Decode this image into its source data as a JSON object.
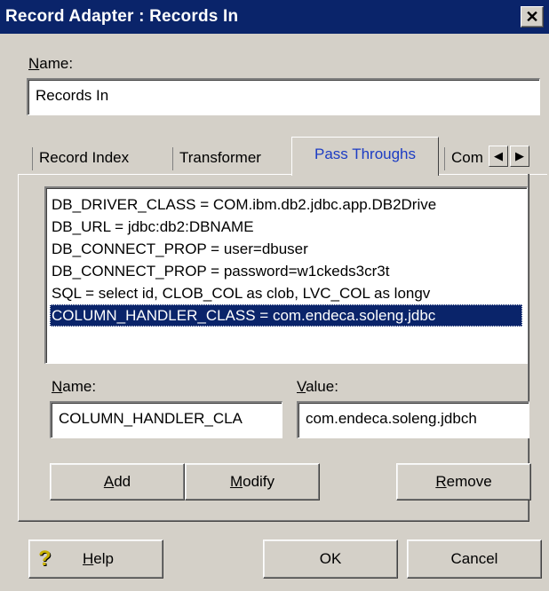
{
  "window": {
    "title": "Record Adapter : Records In",
    "close_glyph": "✕"
  },
  "name_field": {
    "label_underlined": "N",
    "label_rest": "ame:",
    "value": "Records In"
  },
  "tabs": [
    {
      "label": "Record Index"
    },
    {
      "label": "Transformer"
    },
    {
      "label": "Pass Throughs"
    },
    {
      "label": "Com"
    }
  ],
  "tab_scroll": {
    "left": "◀",
    "right": "▶"
  },
  "pass_throughs": [
    "DB_DRIVER_CLASS = COM.ibm.db2.jdbc.app.DB2Drive",
    "DB_URL = jdbc:db2:DBNAME",
    "DB_CONNECT_PROP = user=dbuser",
    "DB_CONNECT_PROP = password=w1ckeds3cr3t",
    "SQL = select id, CLOB_COL as clob, LVC_COL as longv",
    "COLUMN_HANDLER_CLASS = com.endeca.soleng.jdbc"
  ],
  "selected_index": 5,
  "pt_name": {
    "label_underlined": "N",
    "label_rest": "ame:",
    "value": "COLUMN_HANDLER_CLA"
  },
  "pt_value": {
    "label_underlined": "V",
    "label_rest": "alue:",
    "value": "com.endeca.soleng.jdbch"
  },
  "buttons": {
    "add": {
      "underlined": "A",
      "rest": "dd"
    },
    "modify": {
      "underlined": "M",
      "rest": "odify"
    },
    "remove": {
      "underlined": "R",
      "rest": "emove"
    },
    "help": {
      "underlined": "H",
      "rest": "elp"
    },
    "ok": "OK",
    "cancel": "Cancel"
  },
  "help_icon_glyph": "?"
}
